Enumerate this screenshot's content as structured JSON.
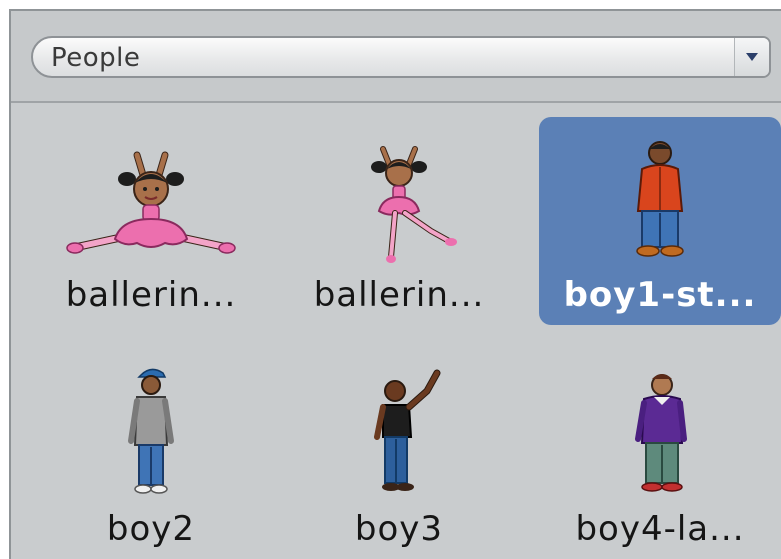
{
  "category": {
    "selected": "People",
    "dropdown_icon": "triangle-down-icon"
  },
  "sprites": [
    {
      "name": "ballerin...",
      "selected": false
    },
    {
      "name": "ballerin...",
      "selected": false
    },
    {
      "name": "boy1-st...",
      "selected": true
    },
    {
      "name": "boy2",
      "selected": false
    },
    {
      "name": "boy3",
      "selected": false
    },
    {
      "name": "boy4-la...",
      "selected": false
    }
  ],
  "colors": {
    "selection": "#5b80b6",
    "panel": "#c9ccce",
    "tutu_pink": "#ec6fae",
    "boy1_jacket": "#d9451d",
    "jeans_blue": "#3f74b6",
    "boy4_sweater": "#5b2a94"
  }
}
